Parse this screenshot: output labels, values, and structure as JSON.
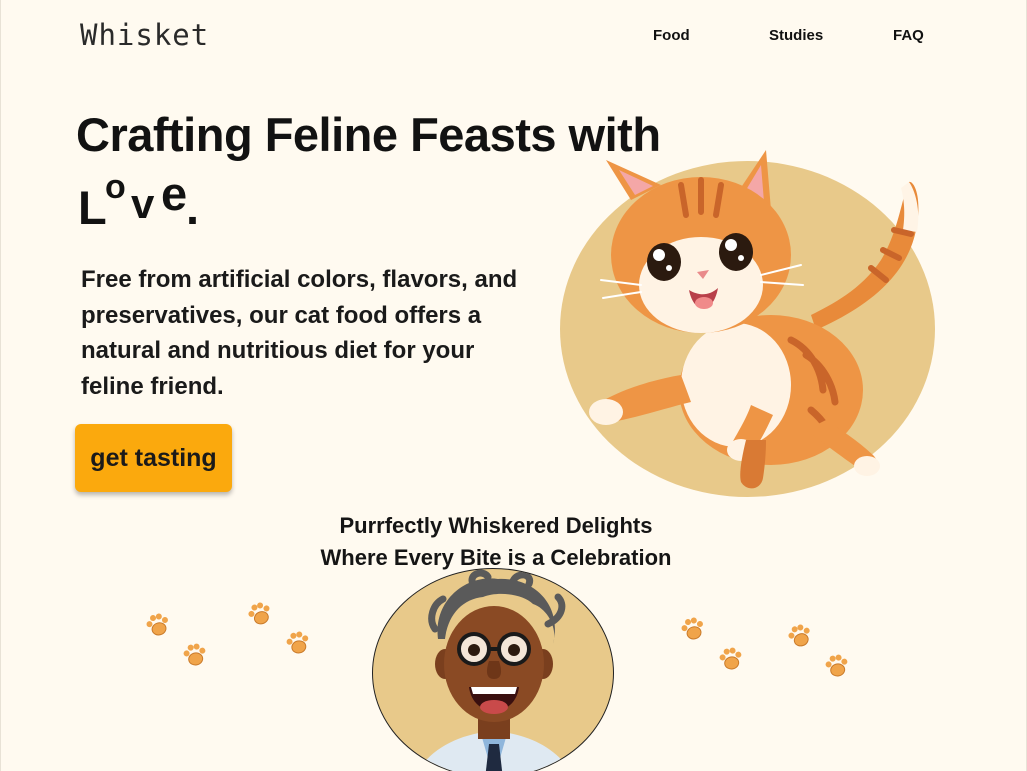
{
  "brand": {
    "logo": "Whisket"
  },
  "nav": {
    "items": [
      {
        "label": "Food"
      },
      {
        "label": "Studies"
      },
      {
        "label": "FAQ"
      }
    ]
  },
  "hero": {
    "title": "Crafting Feline Feasts with",
    "love_letters": [
      "L",
      "o",
      "v",
      "e",
      "."
    ],
    "description": "Free from artificial colors, flavors, and preservatives, our cat food offers a natural and nutritious diet for your feline friend.",
    "cta_label": "get tasting"
  },
  "tagline": {
    "line1": "Purrfectly Whiskered Delights",
    "line2": "Where Every Bite is a Celebration"
  },
  "colors": {
    "background": "#fffaf0",
    "accent": "#fba90d",
    "disc": "#e8c98a",
    "paw": "#f0a44a"
  },
  "icons": {
    "paw": "paw-print-icon",
    "cat": "kitten-illustration",
    "scientist": "scientist-illustration"
  }
}
